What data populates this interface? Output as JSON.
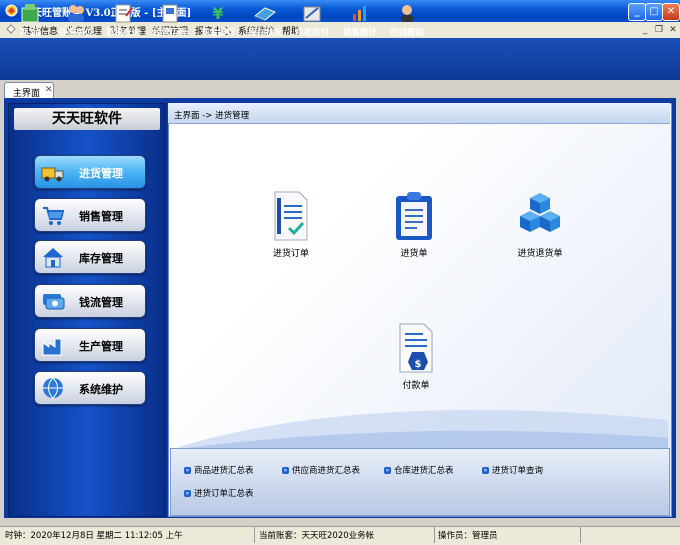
{
  "window": {
    "title": "天天旺管账宝 V3.0正式版 - [主界面]"
  },
  "menubar": {
    "items": [
      "基本信息",
      "业务处理",
      "财务处理",
      "单据管理",
      "报表中心",
      "系统维护",
      "帮助"
    ]
  },
  "toolbar": {
    "items": [
      {
        "label": "商  品",
        "icon": "product-icon"
      },
      {
        "label": "往来单位",
        "icon": "contacts-icon"
      },
      {
        "label": "草稿查询",
        "icon": "draft-icon"
      },
      {
        "label": "经营历程",
        "icon": "history-icon"
      },
      {
        "label": "现金银行",
        "icon": "cash-icon"
      },
      {
        "label": "库存状况",
        "icon": "inventory-icon"
      },
      {
        "label": "应收应付",
        "icon": "receivable-icon"
      },
      {
        "label": "销售统计",
        "icon": "sales-stats-icon"
      },
      {
        "label": "在线帮助",
        "icon": "help-icon"
      }
    ]
  },
  "tabs": [
    {
      "label": "主界面",
      "close": "✕"
    }
  ],
  "sidebar": {
    "brand": "天天旺软件",
    "items": [
      {
        "label": "进货管理",
        "icon": "truck-icon",
        "active": true
      },
      {
        "label": "销售管理",
        "icon": "cart-icon",
        "active": false
      },
      {
        "label": "库存管理",
        "icon": "house-icon",
        "active": false
      },
      {
        "label": "钱流管理",
        "icon": "money-icon",
        "active": false
      },
      {
        "label": "生产管理",
        "icon": "factory-icon",
        "active": false
      },
      {
        "label": "系统维护",
        "icon": "globe-icon",
        "active": false
      }
    ]
  },
  "content": {
    "breadcrumb": "主界面 -> 进货管理",
    "functions": [
      {
        "label": "进货订单",
        "icon": "order-document-icon"
      },
      {
        "label": "进货单",
        "icon": "clipboard-icon"
      },
      {
        "label": "进货退货单",
        "icon": "boxes-icon"
      },
      {
        "label": "付款单",
        "icon": "payment-document-icon"
      }
    ],
    "links": [
      "商品进货汇总表",
      "供应商进货汇总表",
      "仓库进货汇总表",
      "进货订单查询",
      "进货订单汇总表"
    ]
  },
  "statusbar": {
    "time": "时钟：2020年12月8日 星期二 11:12:05 上午",
    "account": "当前账套：天天旺2020业务帐",
    "operator": "操作员：管理员"
  },
  "colors": {
    "titlebar": "#0a5ad6",
    "toolbar": "#1a4fb8",
    "sidebar": "#1553c8",
    "active_nav": "#4ab4f4"
  }
}
